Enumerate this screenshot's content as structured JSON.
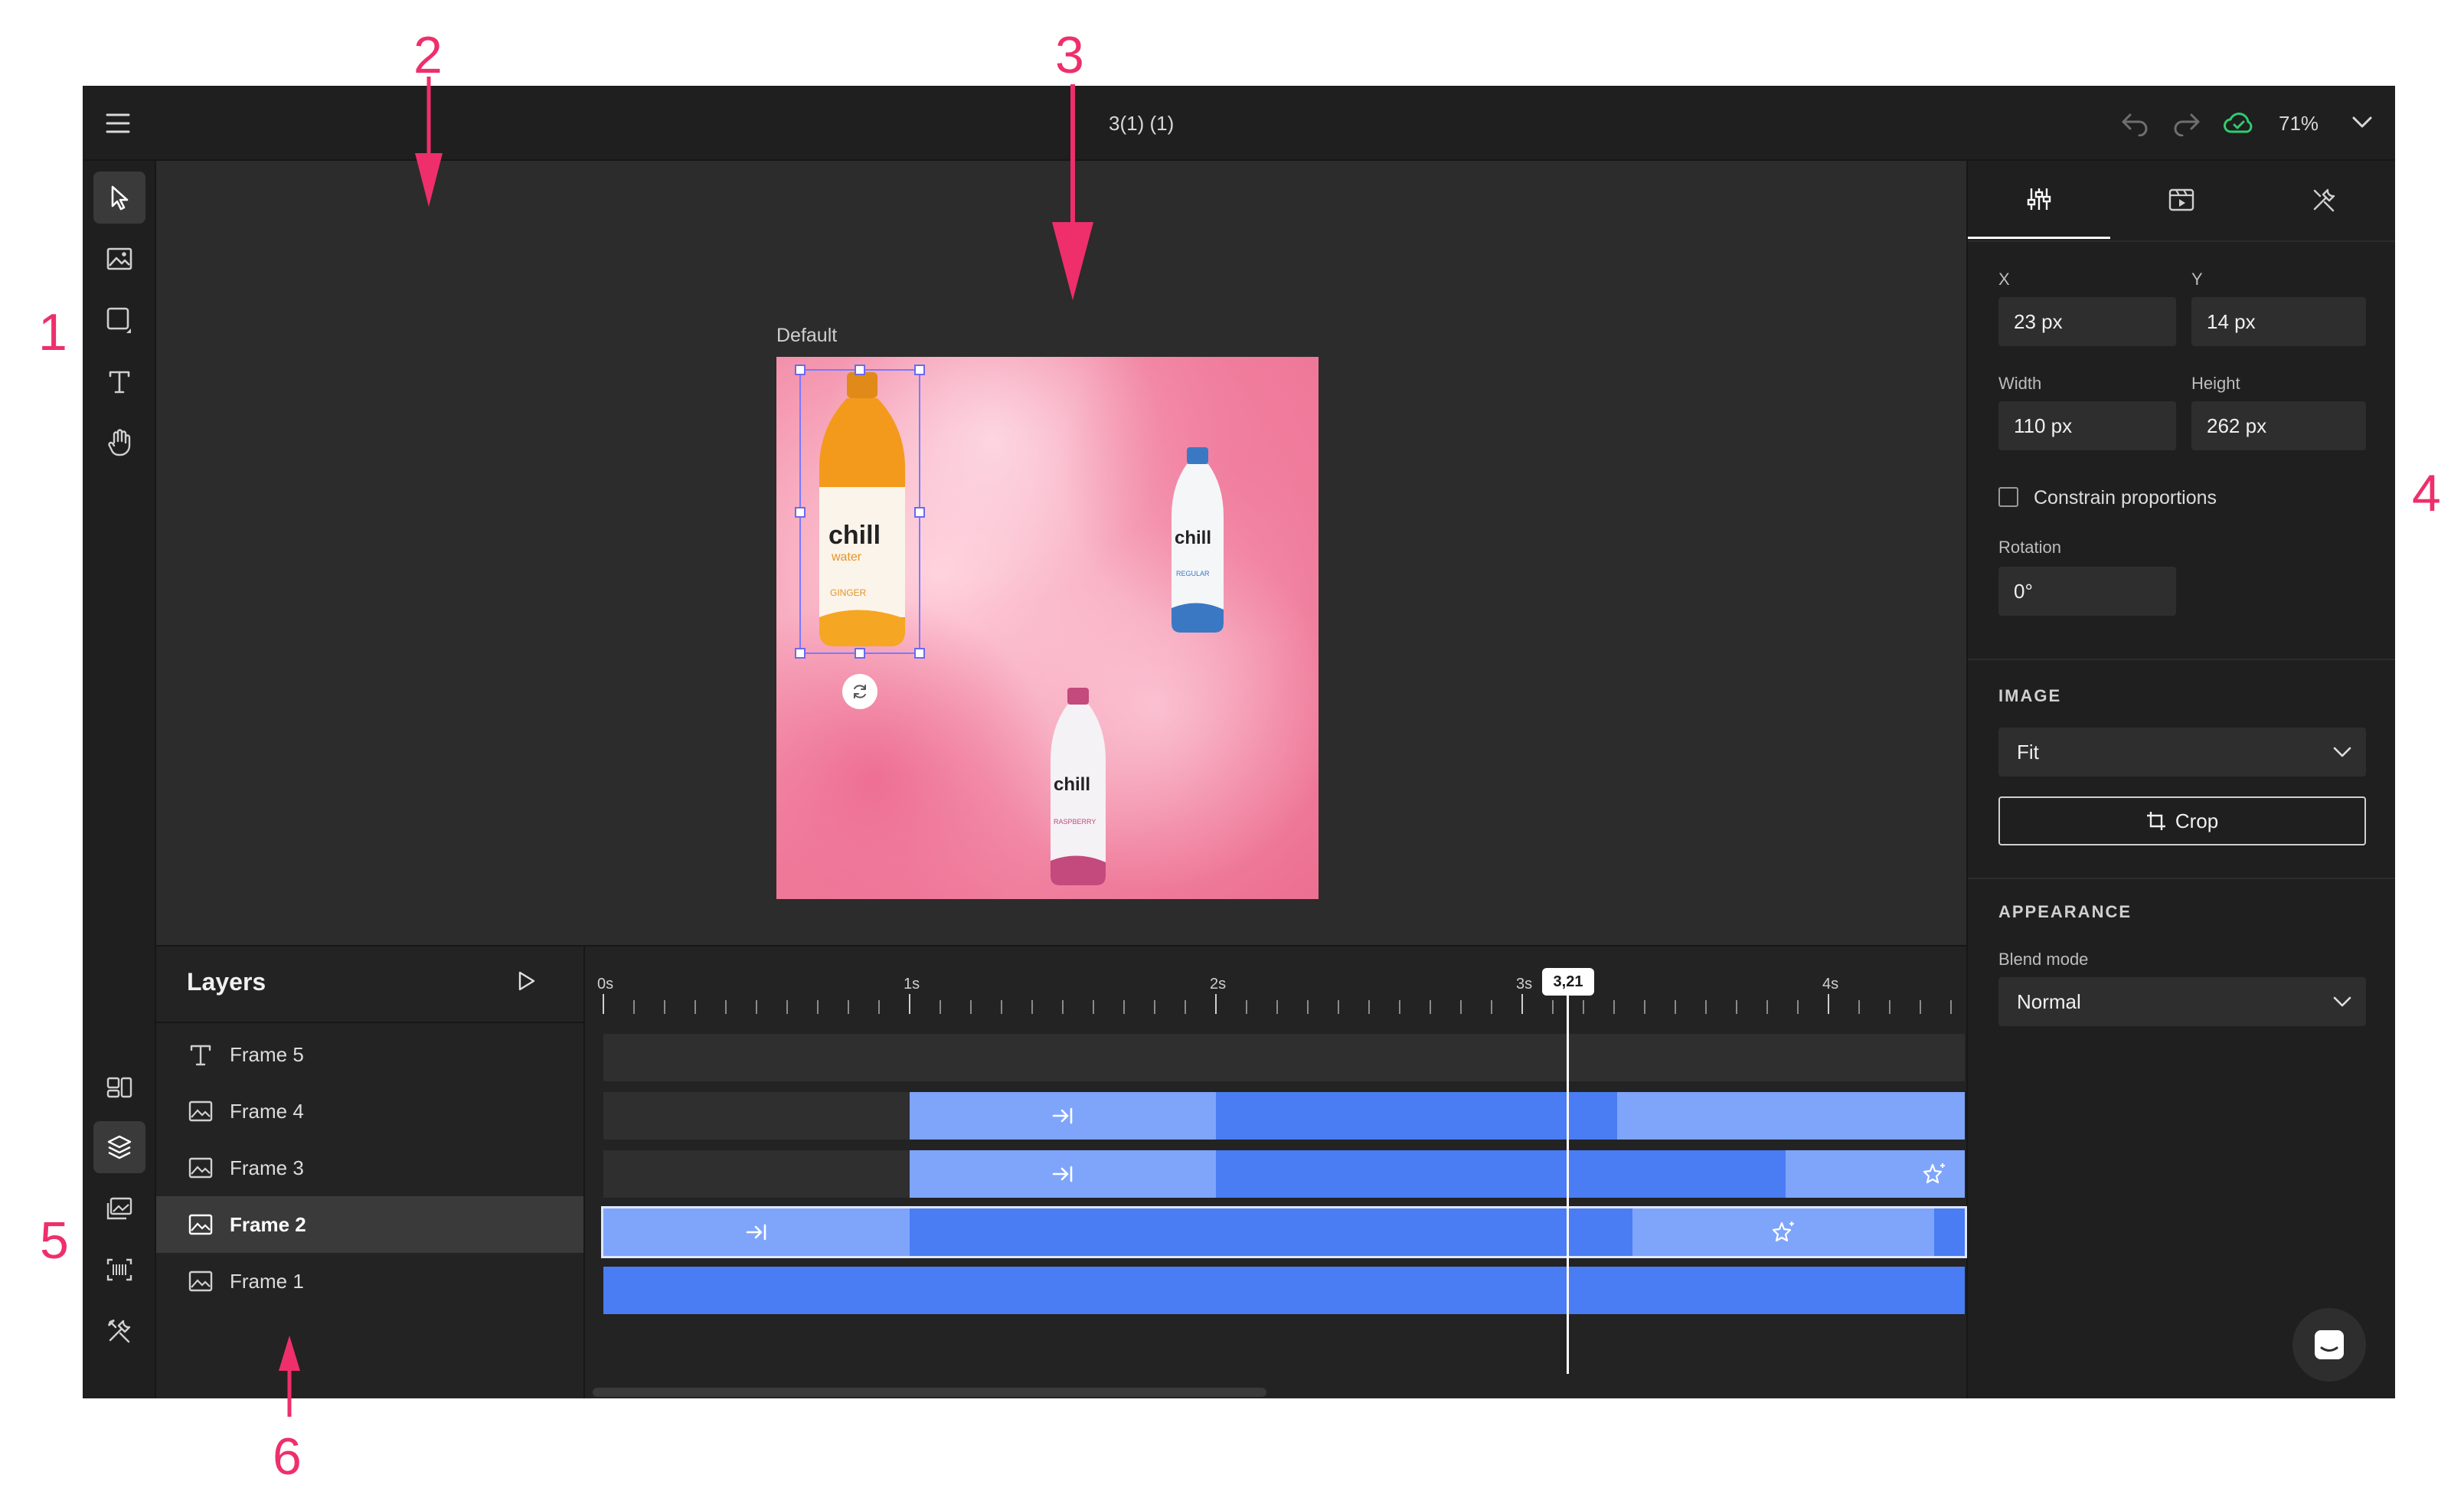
{
  "document": {
    "title": "3(1) (1)",
    "zoom": "71%"
  },
  "canvas": {
    "artboard_label": "Default"
  },
  "left_toolbar": {
    "tools": [
      "select-tool",
      "image-tool",
      "shape-tool",
      "text-tool",
      "hand-tool"
    ],
    "bottom": [
      "templates-tool",
      "layers-tool",
      "media-tool",
      "barcode-tool",
      "tools-tool"
    ]
  },
  "right_panel": {
    "tabs": [
      "adjust-tab",
      "animation-tab",
      "tools-tab"
    ],
    "x_label": "X",
    "x_value": "23 px",
    "y_label": "Y",
    "y_value": "14 px",
    "width_label": "Width",
    "width_value": "110 px",
    "height_label": "Height",
    "height_value": "262 px",
    "constrain_label": "Constrain proportions",
    "constrain_checked": false,
    "rotation_label": "Rotation",
    "rotation_value": "0°",
    "image_title": "IMAGE",
    "fit_value": "Fit",
    "crop_label": "Crop",
    "appearance_title": "APPEARANCE",
    "blend_label": "Blend mode",
    "blend_value": "Normal"
  },
  "layers": {
    "title": "Layers",
    "items": [
      {
        "name": "Frame 5",
        "icon": "text-icon",
        "selected": false
      },
      {
        "name": "Frame 4",
        "icon": "image-icon",
        "selected": false
      },
      {
        "name": "Frame 3",
        "icon": "image-icon",
        "selected": false
      },
      {
        "name": "Frame 2",
        "icon": "image-icon",
        "selected": true
      },
      {
        "name": "Frame 1",
        "icon": "image-icon",
        "selected": false
      }
    ]
  },
  "timeline": {
    "ticks": [
      "0s",
      "1s",
      "2s",
      "3s",
      "4s"
    ],
    "playhead": "3,21"
  },
  "annotations": [
    "1",
    "2",
    "3",
    "4",
    "5",
    "6"
  ],
  "colors": {
    "accent": "#ee2f6b",
    "track_blue": "#4a7cf4",
    "track_light": "#7fa5fa",
    "cloud_sync": "#2ecc71"
  }
}
